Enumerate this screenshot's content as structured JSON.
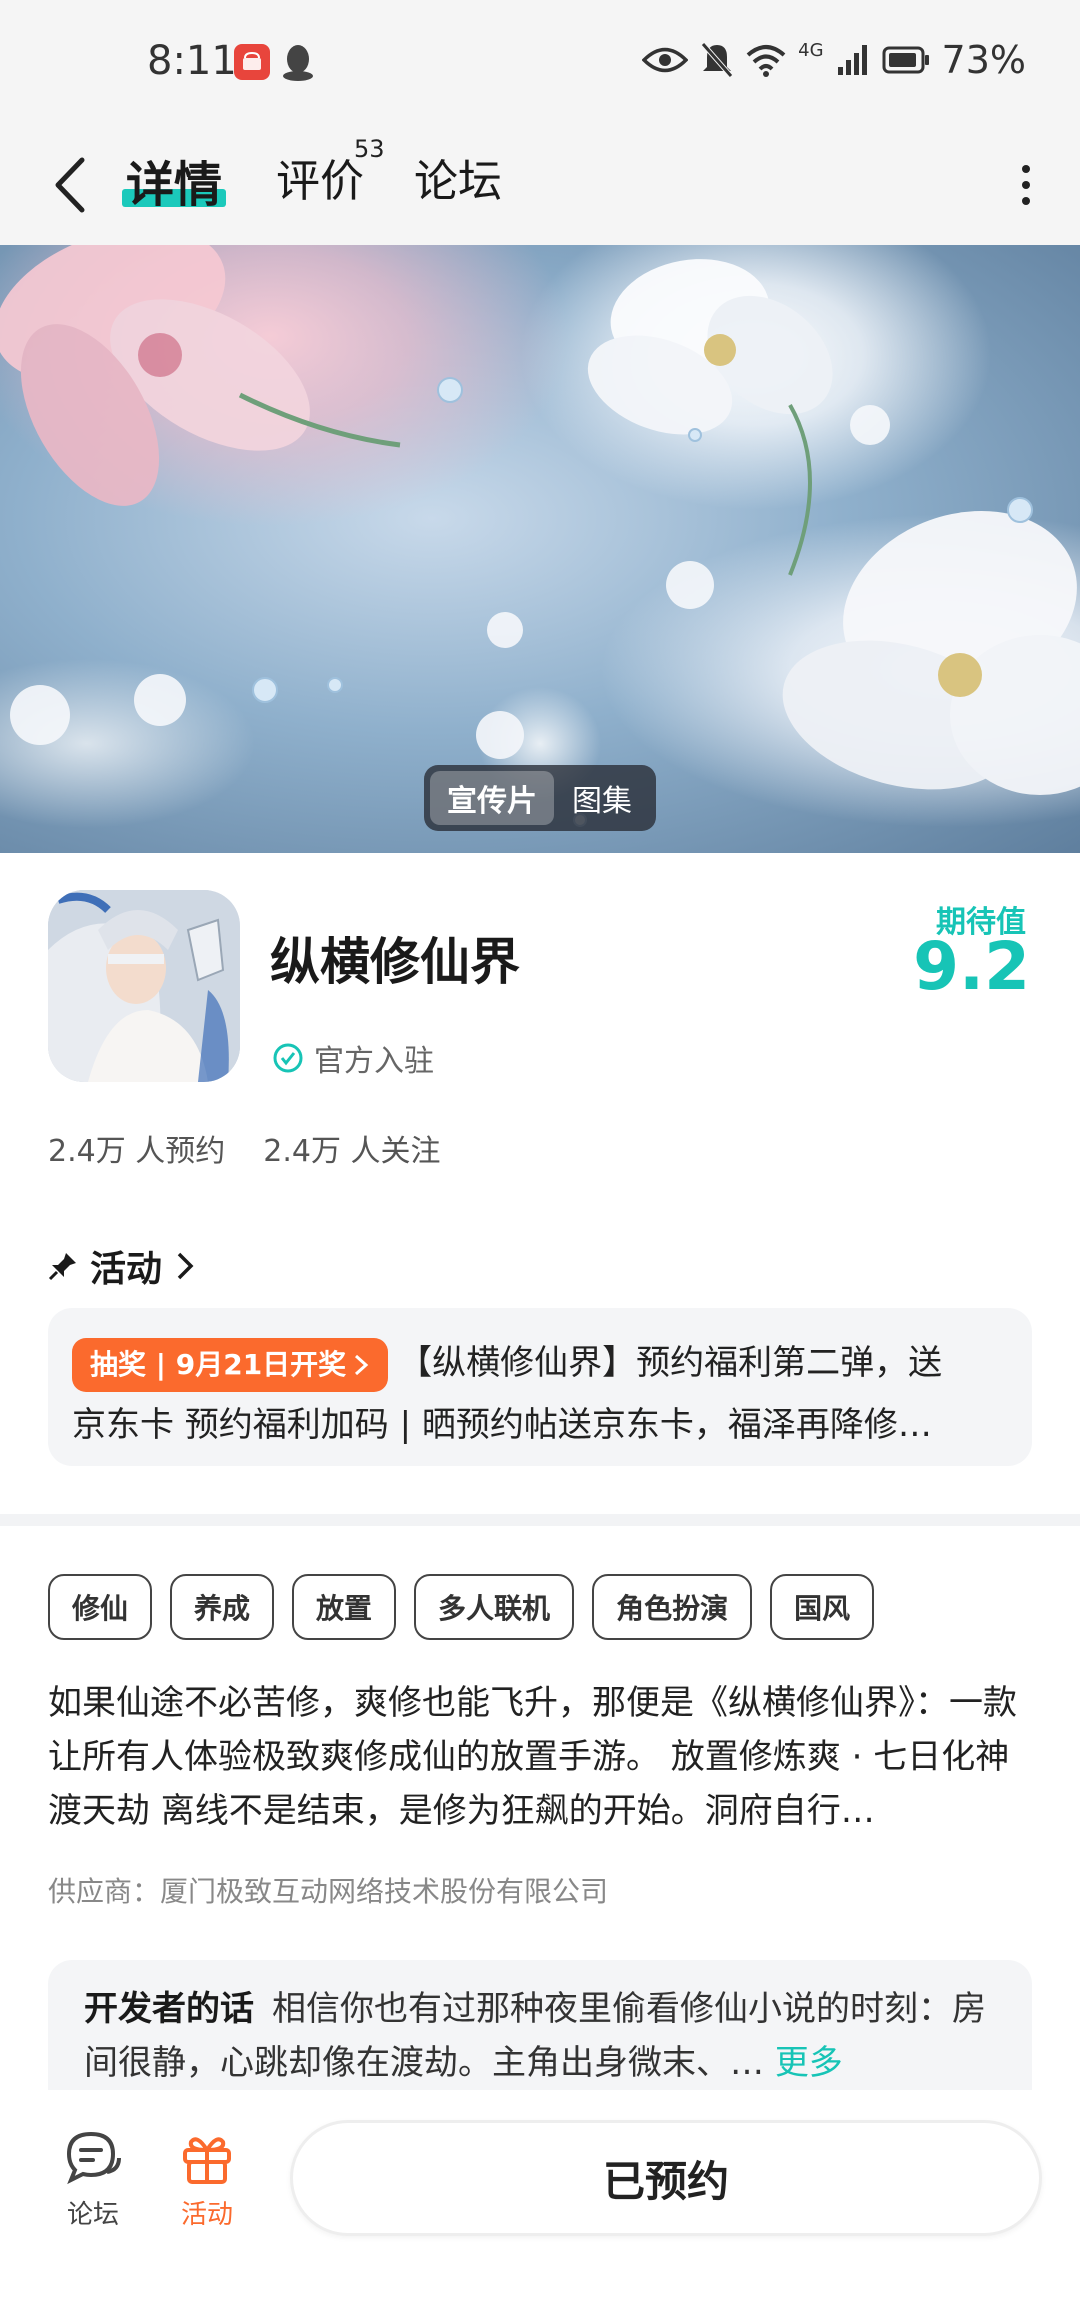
{
  "status_bar": {
    "time": "8:11",
    "network": "4G",
    "battery": "73%"
  },
  "nav": {
    "tabs": [
      {
        "label": "详情"
      },
      {
        "label": "评价",
        "count": "53"
      },
      {
        "label": "论坛"
      }
    ]
  },
  "banner": {
    "toggle": {
      "video": "宣传片",
      "gallery": "图集"
    }
  },
  "game": {
    "name": "纵横修仙界",
    "official": "官方入驻",
    "expect_label": "期待值",
    "expect_score": "9.2",
    "reservations": "2.4万 人预约",
    "followers": "2.4万 人关注"
  },
  "activity": {
    "title": "活动",
    "badge": "抽奖 | 9月21日开奖",
    "text_line1": "【纵横修仙界】预约福利第二弹，送",
    "text_line2": "京东卡 预约福利加码 | 晒预约帖送京东卡，福泽再降修…"
  },
  "tags": [
    "修仙",
    "养成",
    "放置",
    "多人联机",
    "角色扮演",
    "国风"
  ],
  "description": "如果仙途不必苦修，爽修也能飞升，那便是《纵横修仙界》：一款让所有人体验极致爽修成仙的放置手游。 放置修炼爽 · 七日化神渡天劫 离线不是结束，是修为狂飙的开始。洞府自行…",
  "supplier": "供应商：厦门极致互动网络技术股份有限公司",
  "developer": {
    "title": "开发者的话",
    "text": "相信你也有过那种夜里偷看修仙小说的时刻：房间很静，心跳却像在渡劫。主角出身微末、…",
    "more": "更多"
  },
  "bottom": {
    "forum": "论坛",
    "activity": "活动",
    "reserved": "已预约"
  },
  "colors": {
    "accent": "#17c4b6",
    "orange": "#fb6a2d"
  }
}
